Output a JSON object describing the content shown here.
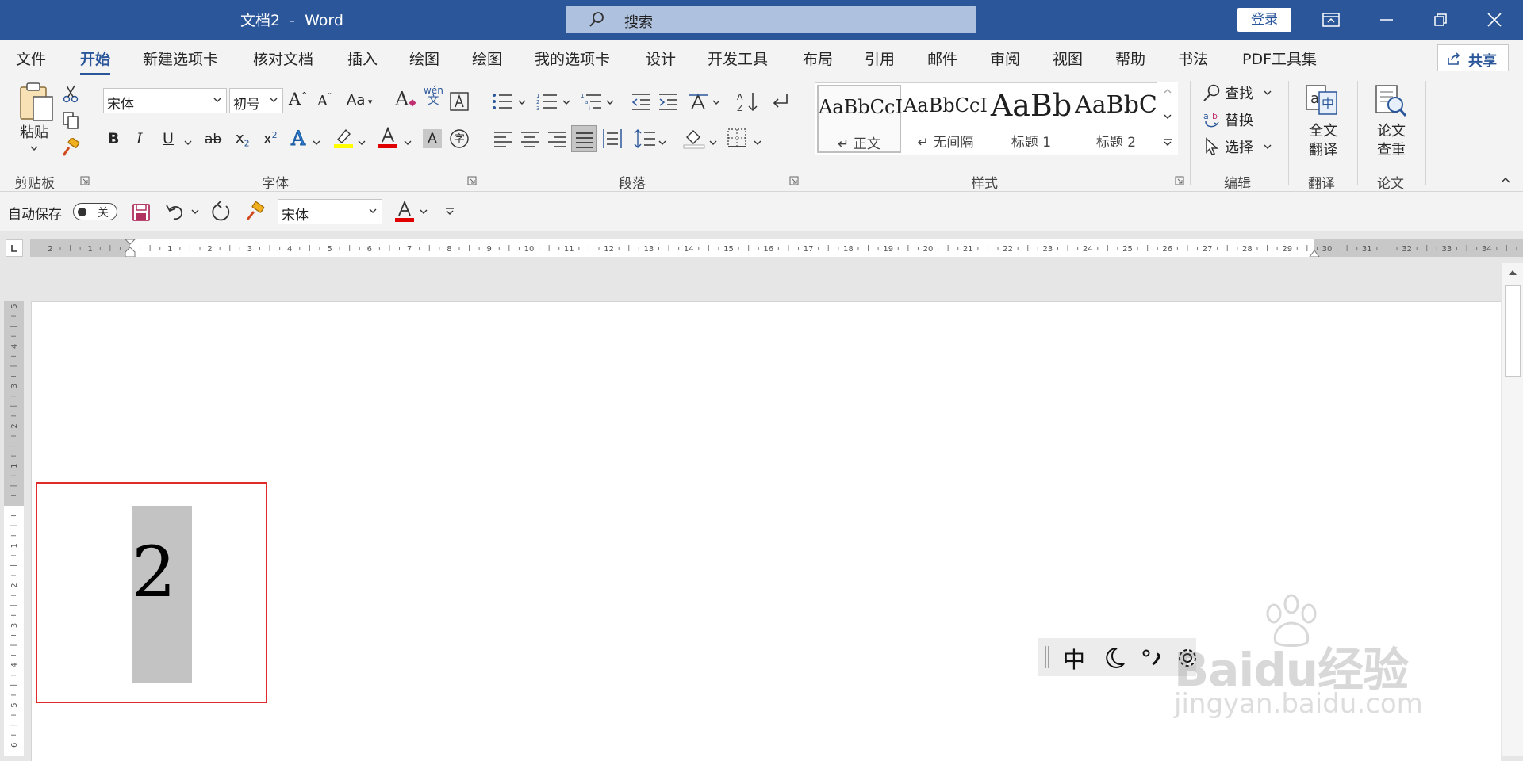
{
  "titlebar": {
    "title": "文档2  -  Word",
    "search_placeholder": "搜索",
    "login_label": "登录"
  },
  "tabs": [
    "文件",
    "开始",
    "新建选项卡",
    "核对文档",
    "插入",
    "绘图",
    "绘图",
    "我的选项卡",
    "设计",
    "开发工具",
    "布局",
    "引用",
    "邮件",
    "审阅",
    "视图",
    "帮助",
    "书法",
    "PDF工具集"
  ],
  "active_tab": "开始",
  "share_label": "共享",
  "ribbon": {
    "clipboard": {
      "label": "剪贴板",
      "paste_label": "粘贴"
    },
    "font": {
      "label": "字体",
      "font_name": "宋体",
      "font_size": "初号",
      "change_case": "Aa",
      "phonetic_top": "wén",
      "phonetic_bottom": "文"
    },
    "paragraph": {
      "label": "段落"
    },
    "styles": {
      "label": "样式",
      "items": [
        {
          "sample": "AaBbCcI",
          "name": "↵ 正文"
        },
        {
          "sample": "AaBbCcI",
          "name": "↵ 无间隔"
        },
        {
          "sample": "AaBb",
          "name": "标题 1"
        },
        {
          "sample": "AaBbC",
          "name": "标题 2"
        }
      ]
    },
    "editing": {
      "label": "编辑",
      "find": "查找",
      "replace": "替换",
      "select": "选择"
    },
    "translate": {
      "label": "翻译",
      "button": "全文\n翻译"
    },
    "paper": {
      "label": "论文",
      "button": "论文\n查重"
    }
  },
  "qat": {
    "autosave_label": "自动保存",
    "autosave_state": "关",
    "font_name": "宋体"
  },
  "document": {
    "content": "2"
  },
  "ime": {
    "mode": "中"
  },
  "watermark": {
    "brand": "Baidu经验",
    "url": "jingyan.baidu.com"
  },
  "colors": {
    "brand": "#2b579a",
    "highlight": "#ffff00",
    "font_color": "#e00000",
    "callout": "#e02b2b",
    "shade": "#c3c3c3"
  }
}
